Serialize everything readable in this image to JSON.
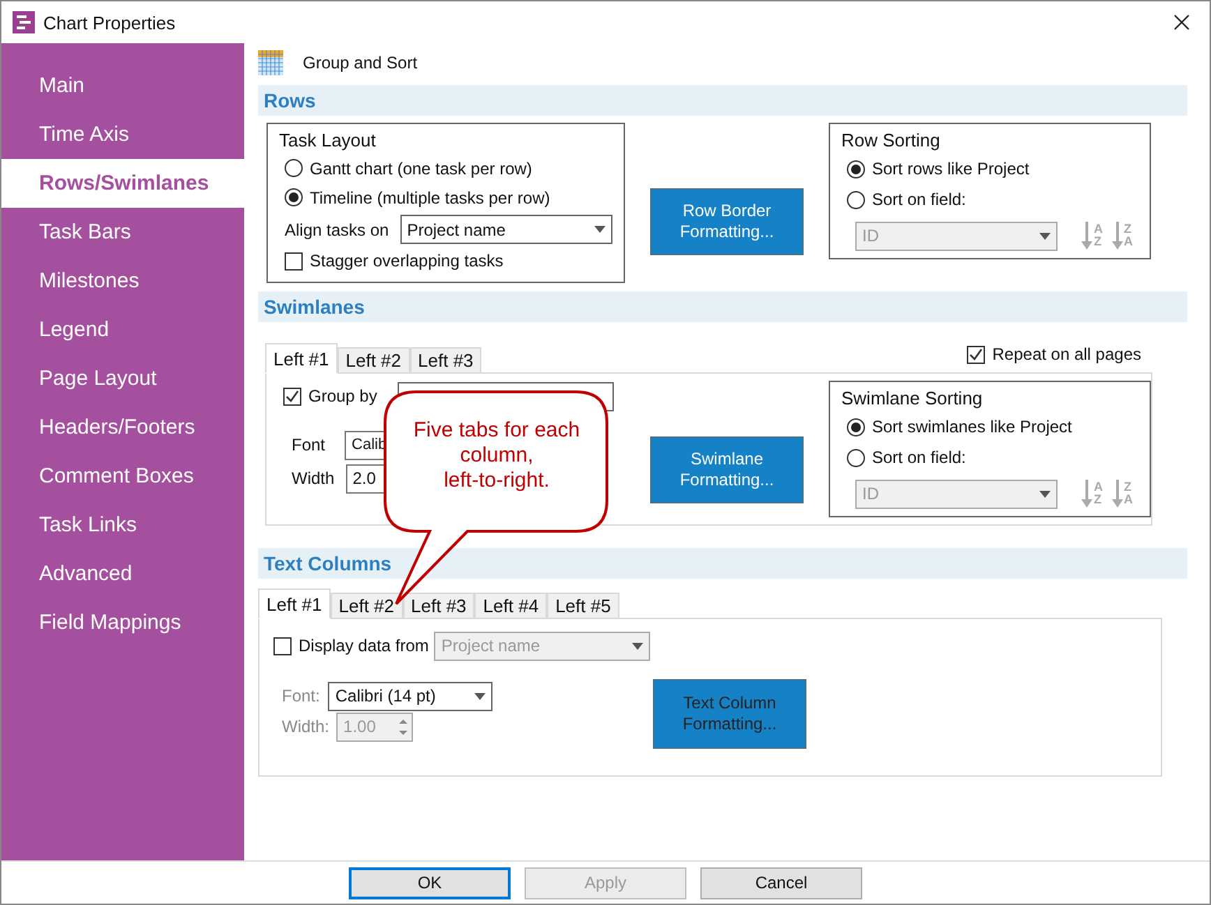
{
  "window": {
    "title": "Chart Properties"
  },
  "sidebar": {
    "items": [
      {
        "label": "Main",
        "selected": false
      },
      {
        "label": "Time Axis",
        "selected": false
      },
      {
        "label": "Rows/Swimlanes",
        "selected": true
      },
      {
        "label": "Task Bars",
        "selected": false
      },
      {
        "label": "Milestones",
        "selected": false
      },
      {
        "label": "Legend",
        "selected": false
      },
      {
        "label": "Page Layout",
        "selected": false
      },
      {
        "label": "Headers/Footers",
        "selected": false
      },
      {
        "label": "Comment Boxes",
        "selected": false
      },
      {
        "label": "Task Links",
        "selected": false
      },
      {
        "label": "Advanced",
        "selected": false
      },
      {
        "label": "Field Mappings",
        "selected": false
      }
    ]
  },
  "page_header": {
    "title": "Group and Sort"
  },
  "rows": {
    "heading": "Rows",
    "task_layout": {
      "title": "Task Layout",
      "options": [
        {
          "label": "Gantt chart (one task per row)",
          "selected": false
        },
        {
          "label": "Timeline (multiple tasks per row)",
          "selected": true
        }
      ],
      "align_label": "Align tasks on",
      "align_value": "Project name",
      "stagger": {
        "label": "Stagger overlapping tasks",
        "checked": false
      }
    },
    "format_button": "Row Border Formatting...",
    "sorting": {
      "title": "Row Sorting",
      "options": [
        {
          "label": "Sort rows like Project",
          "selected": true
        },
        {
          "label": "Sort on field:",
          "selected": false
        }
      ],
      "field_value": "ID",
      "disabled": true,
      "sort_buttons": [
        {
          "letters": [
            "A",
            "Z"
          ]
        },
        {
          "letters": [
            "Z",
            "A"
          ]
        }
      ]
    }
  },
  "swimlanes": {
    "heading": "Swimlanes",
    "tabs": [
      {
        "label": "Left #1",
        "selected": true
      },
      {
        "label": "Left #2",
        "selected": false
      },
      {
        "label": "Left #3",
        "selected": false
      }
    ],
    "repeat": {
      "label": "Repeat on all pages",
      "checked": true
    },
    "group_by": {
      "label": "Group by",
      "checked": true
    },
    "font_label": "Font",
    "font_value": "Calib",
    "width_label": "Width",
    "width_value": "2.0",
    "format_button": "Swimlane Formatting...",
    "sorting": {
      "title": "Swimlane Sorting",
      "options": [
        {
          "label": "Sort swimlanes like Project",
          "selected": true
        },
        {
          "label": "Sort on field:",
          "selected": false
        }
      ],
      "field_value": "ID",
      "disabled": true,
      "sort_buttons": [
        {
          "letters": [
            "A",
            "Z"
          ]
        },
        {
          "letters": [
            "Z",
            "A"
          ]
        }
      ]
    }
  },
  "text_columns": {
    "heading": "Text Columns",
    "tabs": [
      {
        "label": "Left #1",
        "selected": true
      },
      {
        "label": "Left #2",
        "selected": false
      },
      {
        "label": "Left #3",
        "selected": false
      },
      {
        "label": "Left #4",
        "selected": false
      },
      {
        "label": "Left #5",
        "selected": false
      }
    ],
    "display": {
      "label": "Display data from",
      "checked": false,
      "value": "Project name"
    },
    "disabled": true,
    "font_label": "Font:",
    "font_value": "Calibri (14 pt)",
    "width_label": "Width:",
    "width_value": "1.00",
    "format_button": "Text Column Formatting..."
  },
  "callout": {
    "text": "Five tabs for each\ncolumn,\nleft-to-right."
  },
  "footer": {
    "buttons": [
      {
        "label": "OK",
        "disabled": false,
        "default": true
      },
      {
        "label": "Apply",
        "disabled": true,
        "default": false
      },
      {
        "label": "Cancel",
        "disabled": false,
        "default": false
      }
    ]
  }
}
